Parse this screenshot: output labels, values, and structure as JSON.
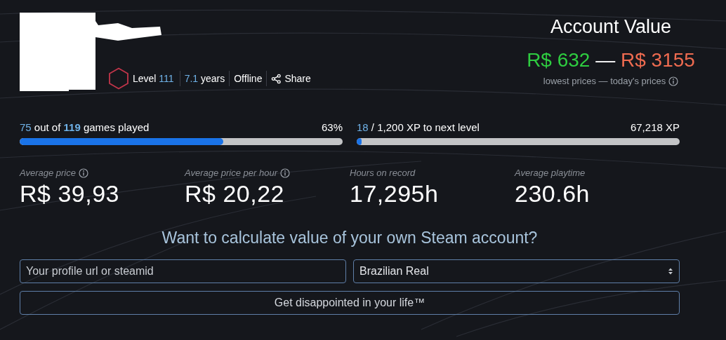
{
  "profile": {
    "level_label": "Level",
    "level": "111",
    "years_value": "7.1",
    "years_label": " years",
    "status": "Offline",
    "share": "Share"
  },
  "account_value": {
    "title": "Account Value",
    "low": "R$ 632",
    "separator": "—",
    "high": "R$ 3155",
    "caption": "lowest prices — today's prices"
  },
  "progress": [
    {
      "count": "75",
      "middle": " out of ",
      "total": "119",
      "suffix": " games played",
      "reading": "63%",
      "level": 0.63
    },
    {
      "count": "18",
      "middle": " / 1,200 XP to next level",
      "reading": "67,218 XP",
      "level": 0.015
    }
  ],
  "stats": [
    {
      "label": "Average price",
      "info": true,
      "value": "R$ 39,93"
    },
    {
      "label": "Average price per hour",
      "info": true,
      "value": "R$ 20,22"
    },
    {
      "label": "Hours on record",
      "info": false,
      "value": "17,295h"
    },
    {
      "label": "Average playtime",
      "info": false,
      "value": "230.6h"
    }
  ],
  "calculator": {
    "heading": "Want to calculate value of your own Steam account?",
    "input_placeholder": "Your profile url or steamid",
    "currency": "Brazilian Real",
    "button": "Get disappointed in your life™"
  }
}
